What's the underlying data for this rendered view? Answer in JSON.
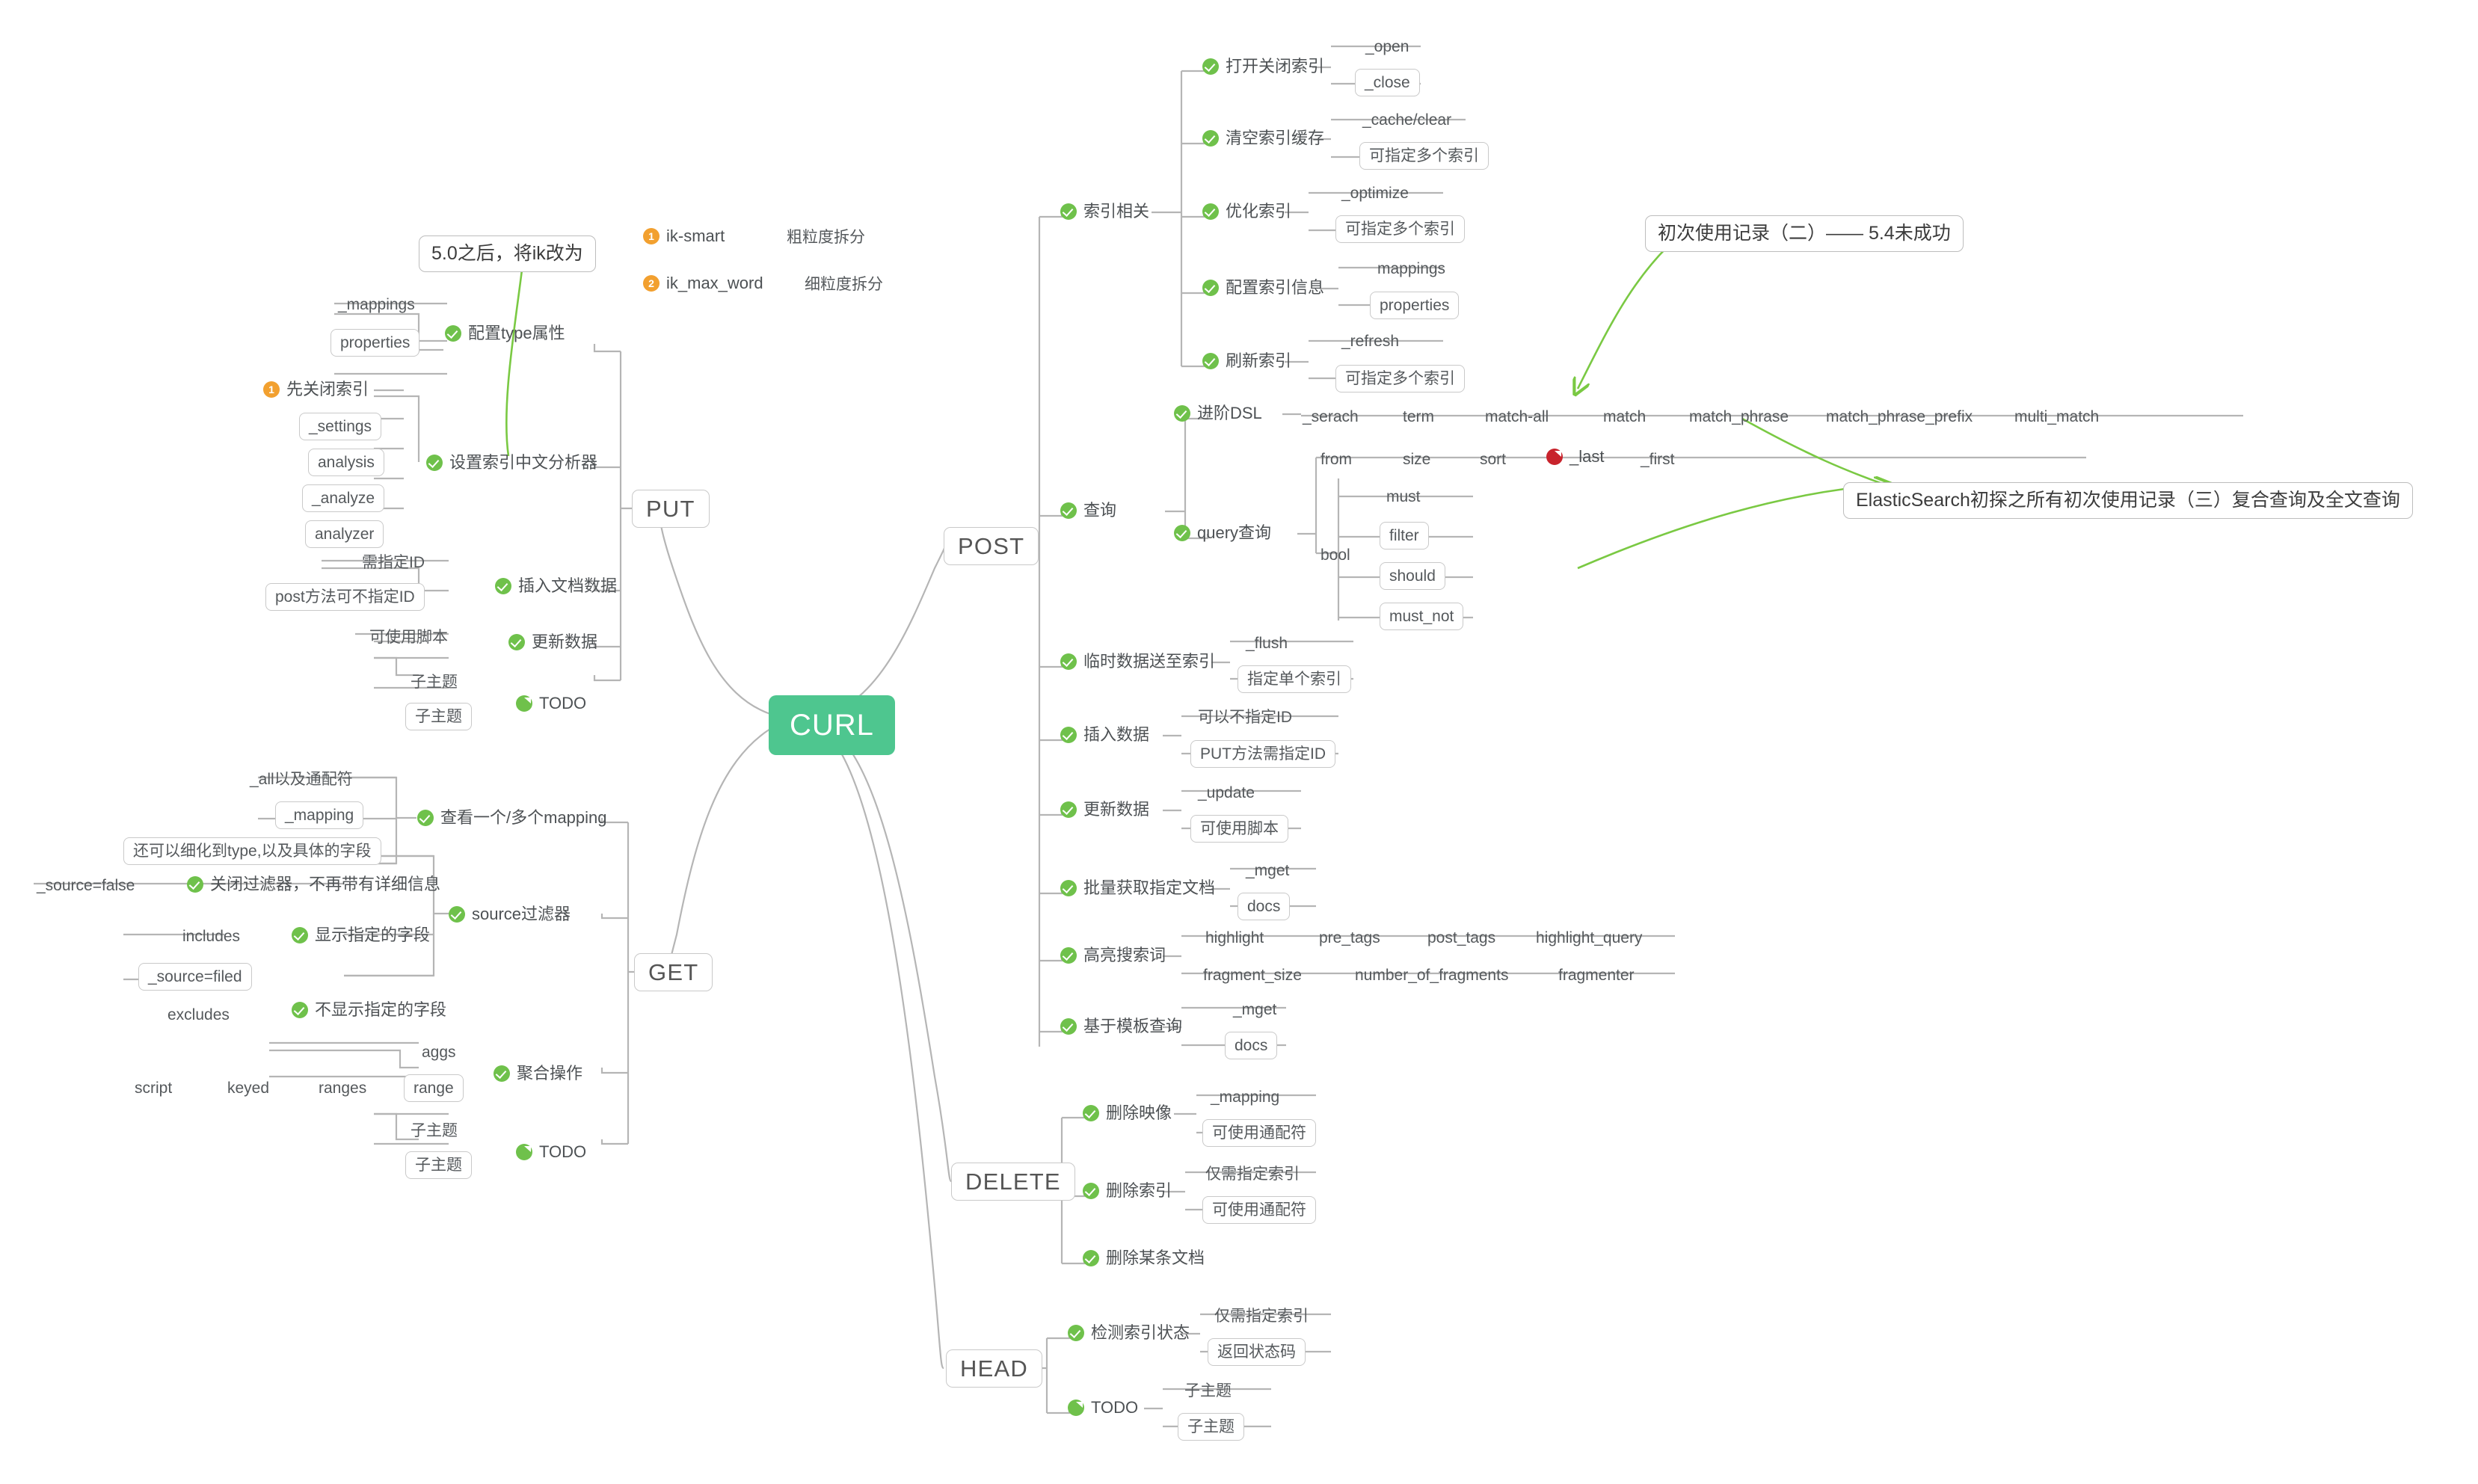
{
  "root": {
    "label": "CURL",
    "color": "#4ec68f"
  },
  "methods": {
    "put": "PUT",
    "get": "GET",
    "post": "POST",
    "delete": "DELETE",
    "head": "HEAD"
  },
  "icons": {
    "check": "check-circle-icon",
    "pie_green": "pie-quarter-green-icon",
    "pie_red": "pie-quarter-red-icon",
    "num1": "1",
    "num2": "2"
  },
  "put_branch": {
    "ik_note": "5.0之后，将ik改为",
    "ik_smart": "ik-smart",
    "ik_smart_desc": "粗粒度拆分",
    "ik_max_word": "ik_max_word",
    "ik_max_word_desc": "细粒度拆分",
    "config_type": "配置type属性",
    "mappings": "_mappings",
    "properties": "properties",
    "set_cn_analyzer": "设置索引中文分析器",
    "close_index_first": "先关闭索引",
    "settings": "_settings",
    "analysis": "analysis",
    "analyze": "_analyze",
    "analyzer": "analyzer",
    "insert_doc": "插入文档数据",
    "need_id": "需指定ID",
    "post_no_id": "post方法可不指定ID",
    "update_data": "更新数据",
    "can_use_script": "可使用脚本",
    "todo": "TODO",
    "subtopic1": "子主题",
    "subtopic2": "子主题"
  },
  "get_branch": {
    "view_mapping": "查看一个/多个mapping",
    "all_wildcard": "_all以及通配符",
    "mapping": "_mapping",
    "refine_type": "还可以细化到type,以及具体的字段",
    "source_filter": "source过滤器",
    "close_filter": "关闭过滤器，不再带有详细信息",
    "source_false": "_source=false",
    "show_fields": "显示指定的字段",
    "includes": "includes",
    "source_filed": "_source=filed",
    "hide_fields": "不显示指定的字段",
    "excludes": "excludes",
    "agg_ops": "聚合操作",
    "aggs": "aggs",
    "script": "script",
    "keyed": "keyed",
    "ranges": "ranges",
    "range": "range",
    "todo": "TODO",
    "subtopic1": "子主题",
    "subtopic2": "子主题"
  },
  "post_branch": {
    "index_related": "索引相关",
    "open_close_index": "打开关闭索引",
    "open": "_open",
    "close": "_close",
    "clear_index_cache": "清空索引缓存",
    "cache_clear": "_cache/clear",
    "multi_index_1": "可指定多个索引",
    "optimize_index": "优化索引",
    "optimize": "_optimize",
    "multi_index_2": "可指定多个索引",
    "config_index_info": "配置索引信息",
    "mappings": "mappings",
    "properties": "properties",
    "refresh_index": "刷新索引",
    "refresh": "_refresh",
    "multi_index_3": "可指定多个索引",
    "query": "查询",
    "advanced_dsl": "进阶DSL",
    "dsl_terms": [
      "_serach",
      "term",
      "match-all",
      "match",
      "match_phrase",
      "match_phrase_prefix",
      "multi_match"
    ],
    "query_query": "query查询",
    "query_terms": [
      "from",
      "size",
      "sort"
    ],
    "sort_last": "_last",
    "sort_first": "_first",
    "bool": "bool",
    "bool_terms": [
      "must",
      "filter",
      "should",
      "must_not"
    ],
    "temp_to_index": "临时数据送至索引",
    "flush": "_flush",
    "single_index": "指定单个索引",
    "insert_data": "插入数据",
    "may_omit_id": "可以不指定ID",
    "put_needs_id": "PUT方法需指定ID",
    "update_data": "更新数据",
    "update": "_update",
    "can_use_script": "可使用脚本",
    "bulk_get_docs": "批量获取指定文档",
    "mget": "_mget",
    "docs": "docs",
    "highlight_terms_row1": [
      "highlight",
      "pre_tags",
      "post_tags",
      "highlight_query"
    ],
    "highlight_terms_row2": [
      "fragment_size",
      "number_of_fragments",
      "fragmenter"
    ],
    "highlight_search": "高亮搜索词",
    "template_query": "基于模板查询",
    "template_mget": "_mget",
    "template_docs": "docs"
  },
  "delete_branch": {
    "delete_mapping_title": "删除映像",
    "mapping": "_mapping",
    "wildcard_1": "可使用通配符",
    "delete_index_title": "删除索引",
    "only_index": "仅需指定索引",
    "wildcard_2": "可使用通配符",
    "delete_doc_title": "删除某条文档"
  },
  "head_branch": {
    "check_index_status": "检测索引状态",
    "only_index": "仅需指定索引",
    "return_status_code": "返回状态码",
    "todo": "TODO",
    "subtopic1": "子主题",
    "subtopic2": "子主题"
  },
  "notes": {
    "note1": "初次使用记录（二）—— 5.4未成功",
    "note2": "ElasticSearch初探之所有初次使用记录（三）复合查询及全文查询"
  }
}
